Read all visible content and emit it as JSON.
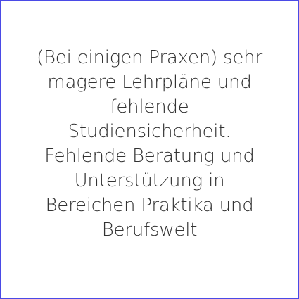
{
  "card": {
    "border_color": "#4a4ae6",
    "text_color": "#333333",
    "text": "(Bei einigen Praxen) sehr\nmagere Lehrpläne und\nfehlende\nStudiensicherheit.\nFehlende Beratung und\nUnterstützung in\nBereichen Praktika und\nBerufswelt"
  }
}
